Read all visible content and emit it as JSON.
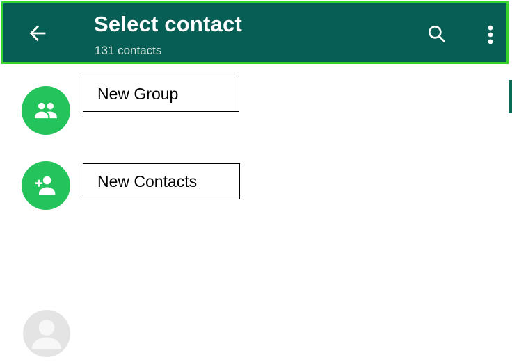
{
  "header": {
    "title": "Select contact",
    "subtitle": "131 contacts"
  },
  "actions": [
    {
      "label": "New Group",
      "icon": "group-icon"
    },
    {
      "label": "New Contacts",
      "icon": "add-person-icon"
    }
  ],
  "colors": {
    "header_bg": "#075e54",
    "header_border": "#36d42a",
    "accent_green": "#25c35b",
    "placeholder_avatar": "#e4e4e4"
  }
}
